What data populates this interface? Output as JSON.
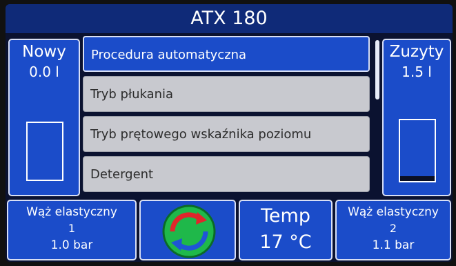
{
  "header": {
    "title": "ATX 180"
  },
  "left_panel": {
    "label": "Nowy",
    "value": "0.0 l",
    "level": 0.0
  },
  "right_panel": {
    "label": "Zuzyty",
    "value": "1.5 l",
    "level": 0.08
  },
  "menu": {
    "items": [
      {
        "label": "Procedura automatyczna",
        "active": true
      },
      {
        "label": "Tryb płukania",
        "active": false
      },
      {
        "label": "Tryb prętowego wskaźnika poziomu",
        "active": false
      },
      {
        "label": "Detergent",
        "active": false
      }
    ]
  },
  "bottom": {
    "hose1": {
      "label": "Wąż elastyczny",
      "number": "1",
      "pressure": "1.0 bar"
    },
    "temp": {
      "label": "Temp",
      "value": "17 °C"
    },
    "hose2": {
      "label": "Wąż elastyczny",
      "number": "2",
      "pressure": "1.1 bar"
    }
  },
  "colors": {
    "panel_blue": "#1b4cc9",
    "title_blue": "#0f2a78",
    "menu_grey": "#c8c9cf",
    "cycle_green": "#1fb84a",
    "cycle_red": "#e0262b",
    "cycle_blue": "#1f55d6"
  }
}
